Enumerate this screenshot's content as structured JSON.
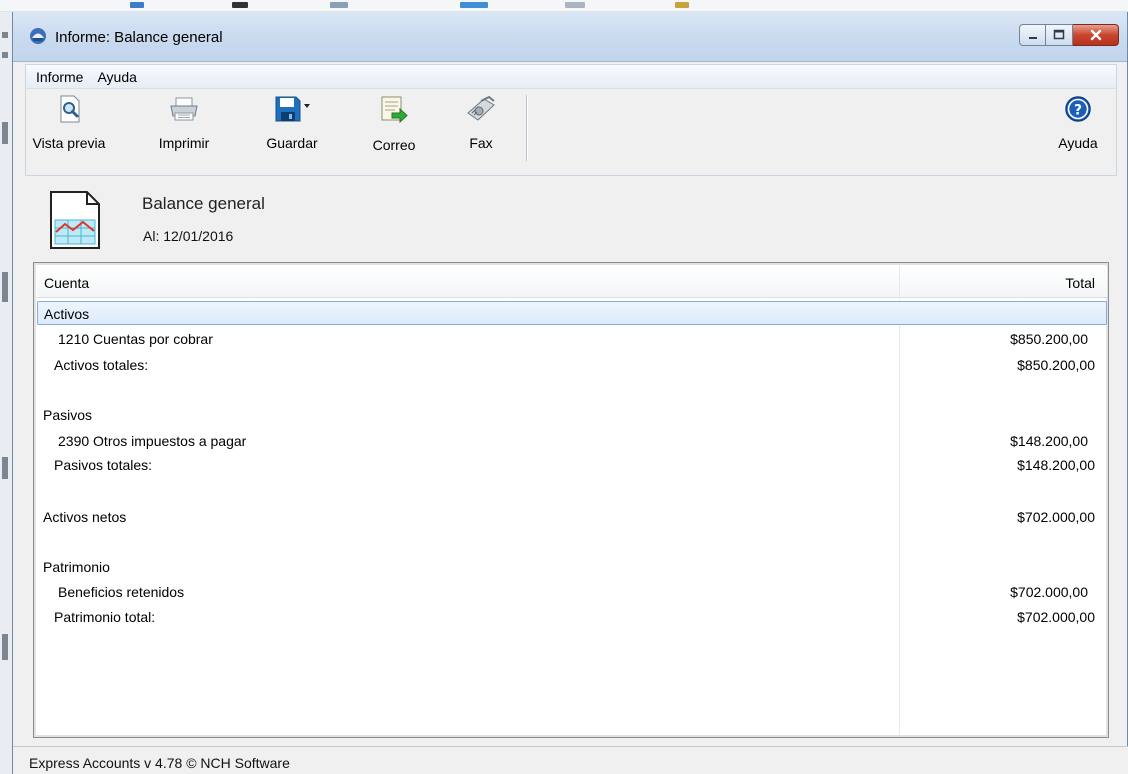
{
  "window": {
    "title": "Informe: Balance general"
  },
  "menu": [
    "Informe",
    "Ayuda"
  ],
  "toolbar": {
    "preview_label": "Vista previa",
    "print_label": "Imprimir",
    "save_label": "Guardar",
    "email_label": "Correo",
    "fax_label": "Fax",
    "help_label": "Ayuda"
  },
  "report": {
    "title": "Balance general",
    "date_line": "Al: 12/01/2016"
  },
  "table": {
    "columns": [
      "Cuenta",
      "Total"
    ],
    "rows": [
      {
        "account": "Activos",
        "total": "",
        "indent": 0,
        "selected": true
      },
      {
        "account": "1210 Cuentas por cobrar",
        "total": "$850.200,00",
        "indent": 2
      },
      {
        "account": "Activos totales:",
        "total": "$850.200,00",
        "indent": 1
      },
      {
        "account": "",
        "total": ""
      },
      {
        "account": "Pasivos",
        "total": "",
        "indent": 0
      },
      {
        "account": "2390 Otros impuestos a pagar",
        "total": "$148.200,00",
        "indent": 2
      },
      {
        "account": "Pasivos totales:",
        "total": "$148.200,00",
        "indent": 1
      },
      {
        "account": "",
        "total": ""
      },
      {
        "account": "Activos netos",
        "total": "$702.000,00",
        "indent": 0
      },
      {
        "account": "",
        "total": ""
      },
      {
        "account": "Patrimonio",
        "total": "",
        "indent": 0
      },
      {
        "account": "Beneficios retenidos",
        "total": "$702.000,00",
        "indent": 2
      },
      {
        "account": "Patrimonio total:",
        "total": "$702.000,00",
        "indent": 1
      }
    ]
  },
  "status": {
    "text": "Express Accounts v 4.78 © NCH Software"
  },
  "colors": {
    "selection": "#dcebfc",
    "selection_border": "#84acdd",
    "titlebar": "#c9daee"
  }
}
